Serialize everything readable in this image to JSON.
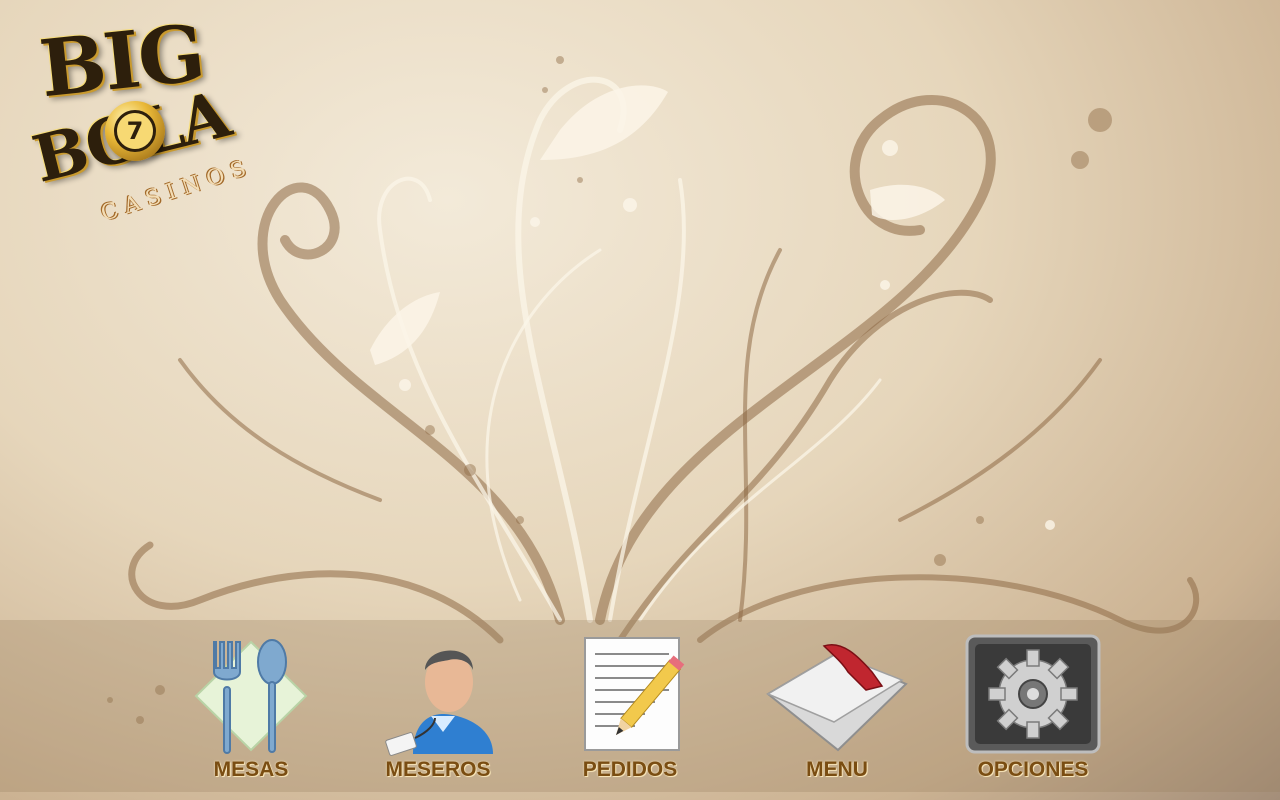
{
  "logo": {
    "word_big": "BIG",
    "word_bola": "BOLA",
    "ball_number": "7",
    "word_casinos": "CASINOS"
  },
  "dock": {
    "items": [
      {
        "label": "MESAS",
        "icon": "cutlery-icon"
      },
      {
        "label": "MESEROS",
        "icon": "waiter-icon"
      },
      {
        "label": "PEDIDOS",
        "icon": "order-notepad-icon"
      },
      {
        "label": "MENU",
        "icon": "menu-folder-icon"
      },
      {
        "label": "OPCIONES",
        "icon": "gear-icon"
      }
    ]
  },
  "colors": {
    "background": "#e6d6bb",
    "label_text": "#7a4d12",
    "swirl_dark": "#8e6a45",
    "swirl_light": "#fbf5e8"
  }
}
